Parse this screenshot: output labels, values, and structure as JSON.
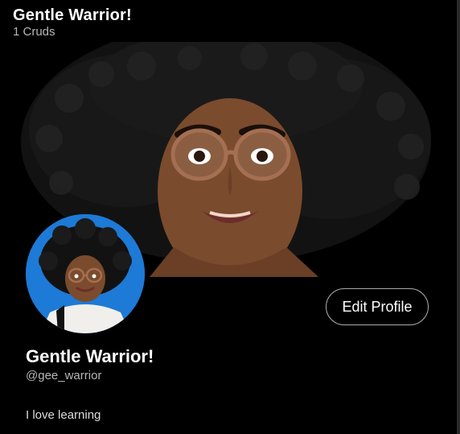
{
  "header": {
    "title": "Gentle Warrior!",
    "count_text": "1 Cruds"
  },
  "banner": {
    "icon": "banner-image"
  },
  "avatar": {
    "icon": "avatar-image"
  },
  "actions": {
    "edit_profile_label": "Edit Profile"
  },
  "profile": {
    "name": "Gentle Warrior!",
    "handle": "@gee_warrior",
    "bio": "I love learning"
  },
  "colors": {
    "background": "#000000",
    "secondary_text": "#b7b7b7",
    "avatar_bg": "#1d7ad6",
    "button_border": "#a8a8a8"
  }
}
